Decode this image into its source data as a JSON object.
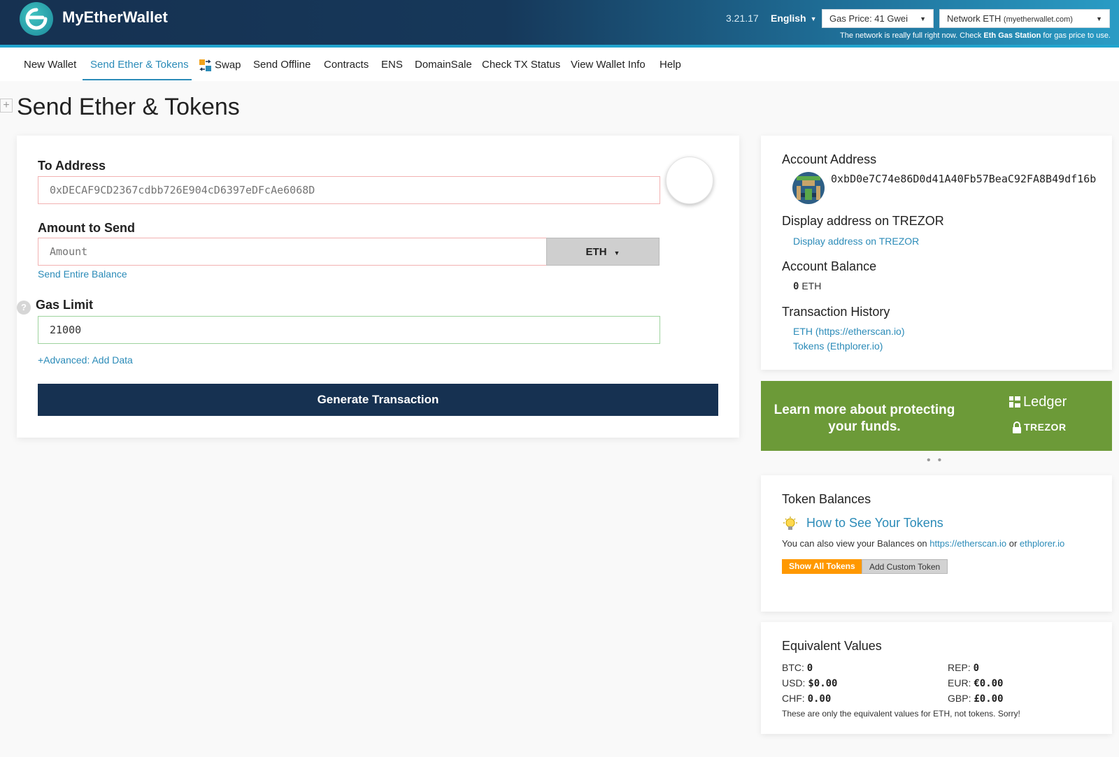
{
  "header": {
    "brand": "MyEtherWallet",
    "version": "3.21.17",
    "language": "English",
    "gas_price": "Gas Price: 41 Gwei",
    "network_label": "Network ETH",
    "network_host": "(myetherwallet.com)",
    "notice_pre": "The network is really full right now. Check ",
    "notice_link": "Eth Gas Station",
    "notice_post": " for gas price to use."
  },
  "nav": {
    "items": [
      "New Wallet",
      "Send Ether & Tokens",
      "Swap",
      "Send Offline",
      "Contracts",
      "ENS",
      "DomainSale",
      "Check TX Status",
      "View Wallet Info",
      "Help"
    ],
    "active": "Send Ether & Tokens"
  },
  "page": {
    "title": "Send Ether & Tokens",
    "expand_symbol": "+"
  },
  "form": {
    "to_label": "To Address",
    "to_placeholder": "0xDECAF9CD2367cdbb726E904cD6397eDFcAe6068D",
    "amount_label": "Amount to Send",
    "amount_placeholder": "Amount",
    "unit": "ETH",
    "send_entire": "Send Entire Balance",
    "gas_label": "Gas Limit",
    "gas_value": "21000",
    "help_symbol": "?",
    "advanced": "+Advanced: Add Data",
    "generate": "Generate Transaction"
  },
  "account": {
    "address_heading": "Account Address",
    "address": "0xbD0e7C74e86D0d41A40Fb57BeaC92FA8B49df16b",
    "display_heading": "Display address on TREZOR",
    "display_link": "Display address on TREZOR",
    "balance_heading": "Account Balance",
    "balance_value": "0",
    "balance_unit": "ETH",
    "history_heading": "Transaction History",
    "history_eth": "ETH (https://etherscan.io)",
    "history_tokens": "Tokens (Ethplorer.io)"
  },
  "banner": {
    "text": "Learn more about protecting your funds.",
    "ledger": "Ledger",
    "trezor": "TREZOR",
    "bg_color": "#6c9a38",
    "dots": "••"
  },
  "tokens": {
    "heading": "Token Balances",
    "how_to": "How to See Your Tokens",
    "desc_pre": "You can also view your Balances on ",
    "desc_link1": "https://etherscan.io",
    "desc_mid": " or ",
    "desc_link2": "ethplorer.io",
    "show_all": "Show All Tokens",
    "add_custom": "Add Custom Token"
  },
  "equivalent": {
    "heading": "Equivalent Values",
    "rows": [
      {
        "label": "BTC:",
        "value": "0"
      },
      {
        "label": "REP:",
        "value": "0"
      },
      {
        "label": "USD:",
        "value": "$0.00"
      },
      {
        "label": "EUR:",
        "value": "€0.00"
      },
      {
        "label": "CHF:",
        "value": "0.00"
      },
      {
        "label": "GBP:",
        "value": "£0.00"
      }
    ],
    "note": "These are only the equivalent values for ETH, not tokens. Sorry!"
  },
  "colors": {
    "header_dark": "#163151",
    "accent": "#2b8bb8",
    "button_dark": "#163151",
    "orange": "#ff9800"
  }
}
